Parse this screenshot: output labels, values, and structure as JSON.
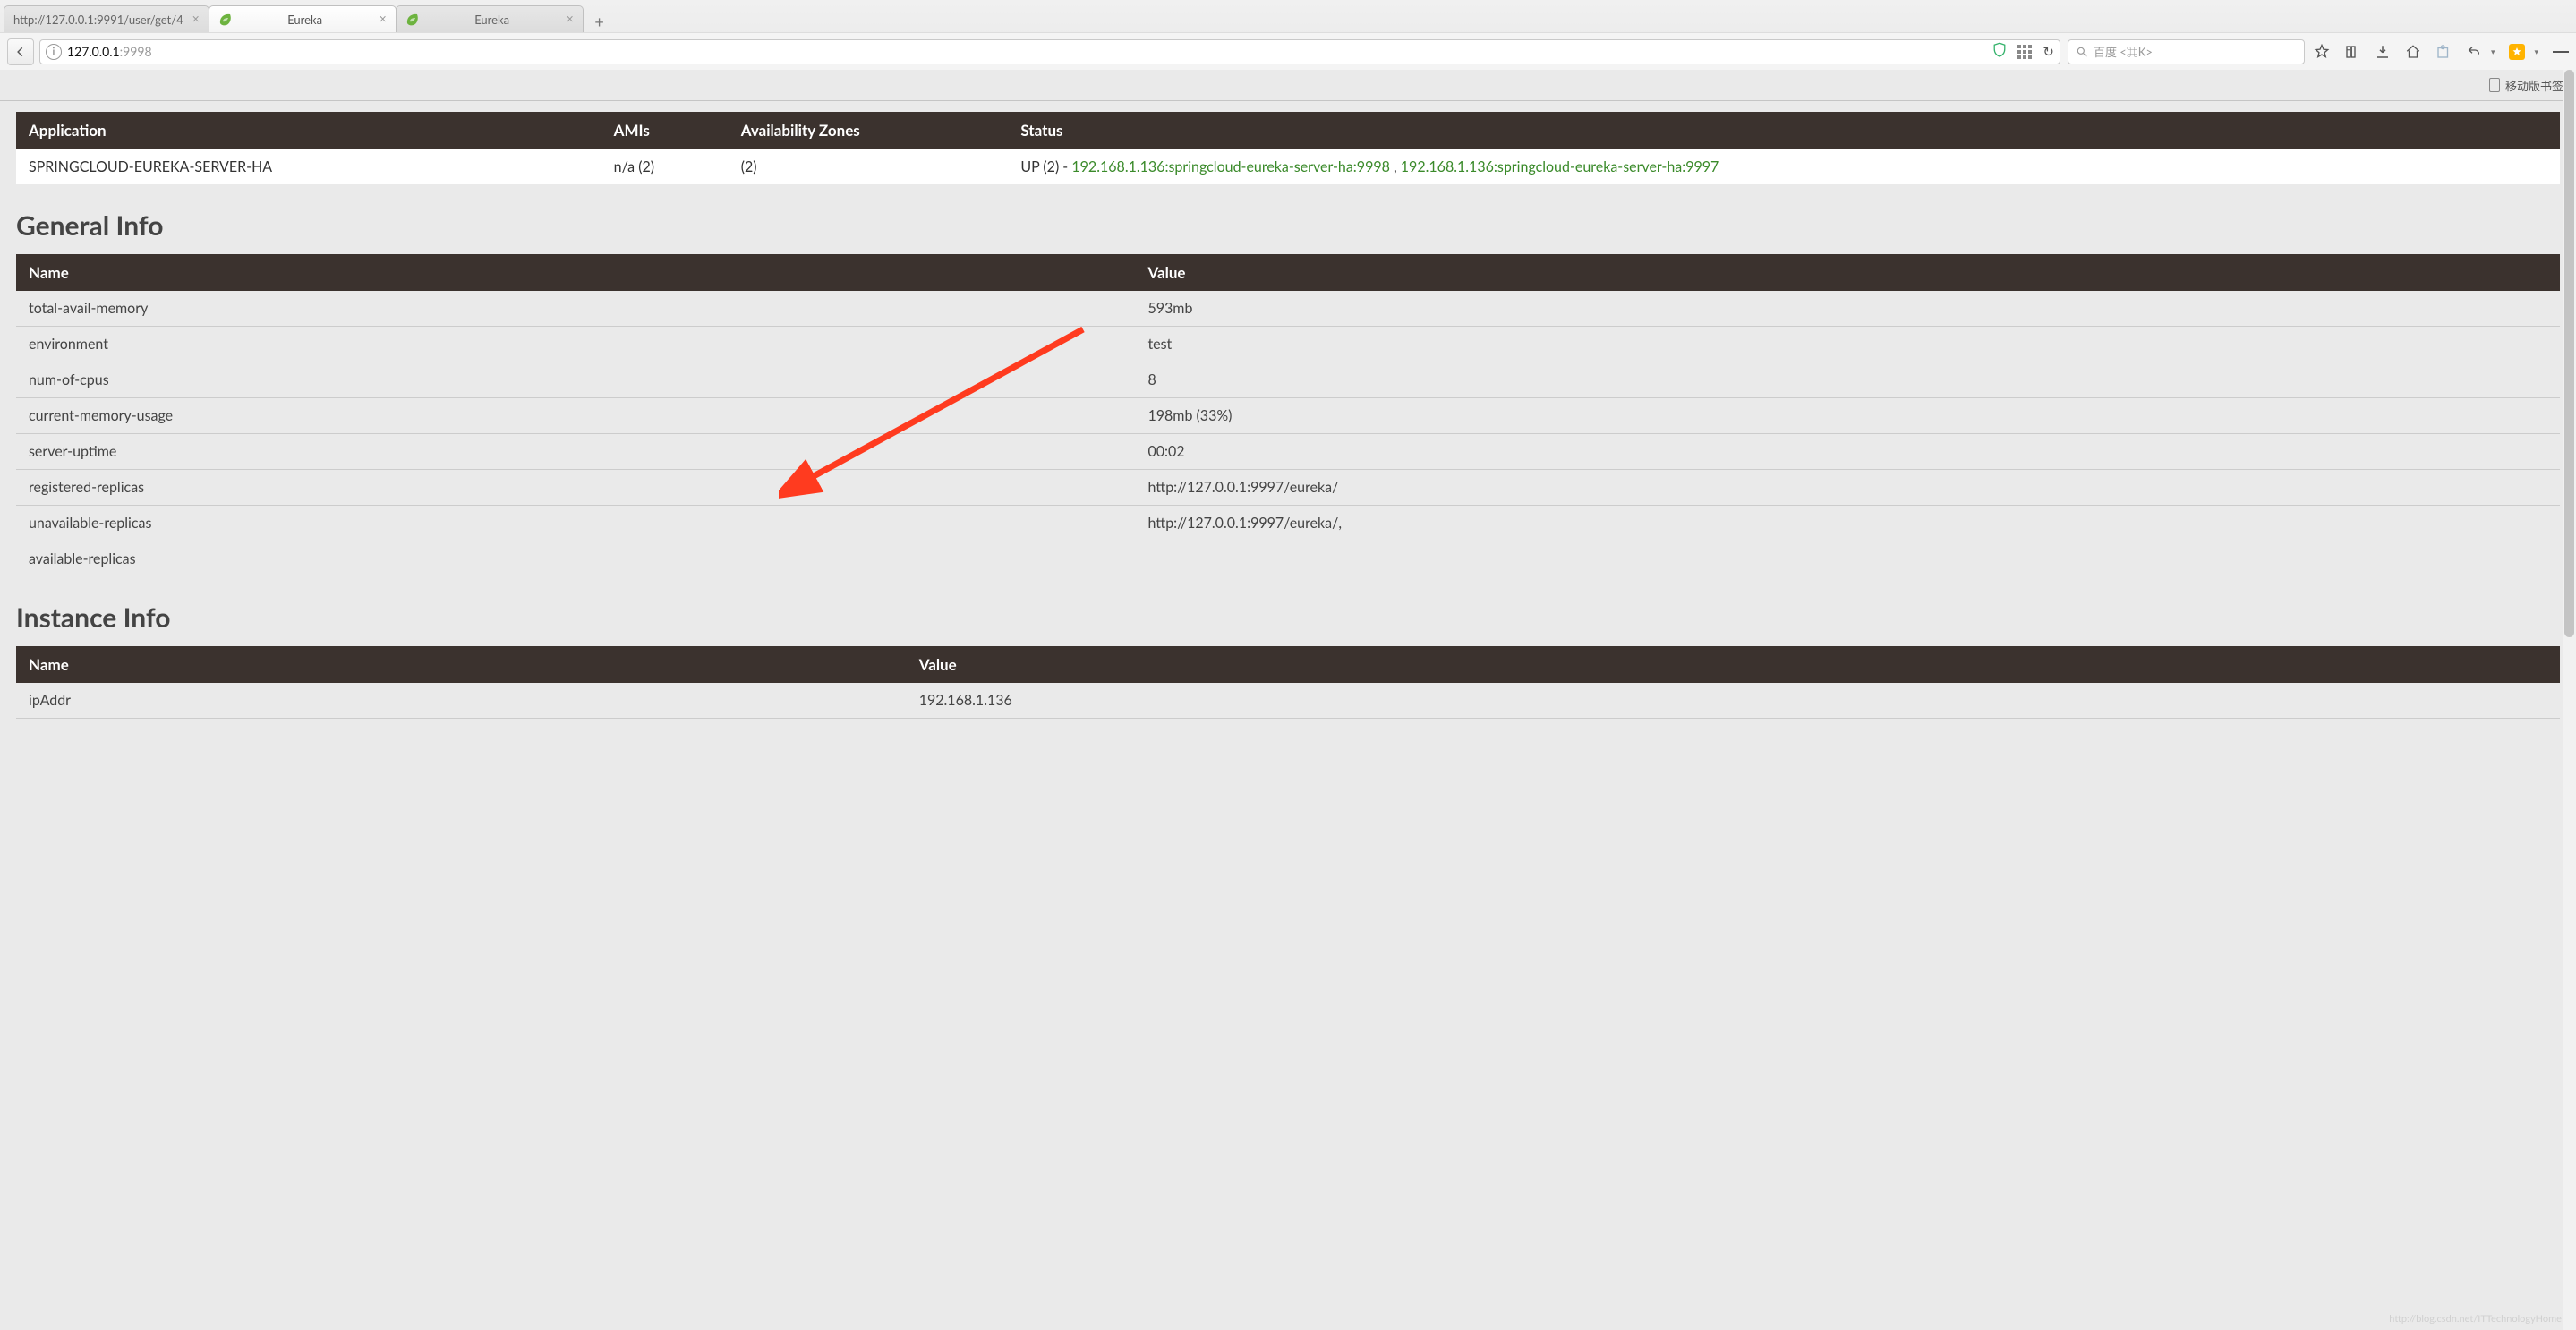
{
  "chrome": {
    "tabs": [
      {
        "title": "http://127.0.0.1:9991/user/get/4",
        "favicon": "none",
        "active": false
      },
      {
        "title": "Eureka",
        "favicon": "spring",
        "active": true
      },
      {
        "title": "Eureka",
        "favicon": "spring",
        "active": false
      }
    ],
    "url_host": "127.0.0.1",
    "url_port": ":9998",
    "search_placeholder": "百度 <⌘K>",
    "bookmark_label": "移动版书签"
  },
  "apps_table": {
    "headers": [
      "Application",
      "AMIs",
      "Availability Zones",
      "Status"
    ],
    "row": {
      "application": "SPRINGCLOUD-EUREKA-SERVER-HA",
      "amis": "n/a (2)",
      "zones": "(2)",
      "status_prefix": "UP (2) - ",
      "status_links": [
        "192.168.1.136:springcloud-eureka-server-ha:9998",
        "192.168.1.136:springcloud-eureka-server-ha:9997"
      ],
      "status_sep": " , "
    }
  },
  "general_info": {
    "title": "General Info",
    "headers": [
      "Name",
      "Value"
    ],
    "rows": [
      {
        "name": "total-avail-memory",
        "value": "593mb"
      },
      {
        "name": "environment",
        "value": "test"
      },
      {
        "name": "num-of-cpus",
        "value": "8"
      },
      {
        "name": "current-memory-usage",
        "value": "198mb (33%)"
      },
      {
        "name": "server-uptime",
        "value": "00:02"
      },
      {
        "name": "registered-replicas",
        "value": "http://127.0.0.1:9997/eureka/"
      },
      {
        "name": "unavailable-replicas",
        "value": "http://127.0.0.1:9997/eureka/,"
      },
      {
        "name": "available-replicas",
        "value": ""
      }
    ]
  },
  "instance_info": {
    "title": "Instance Info",
    "headers": [
      "Name",
      "Value"
    ],
    "rows": [
      {
        "name": "ipAddr",
        "value": "192.168.1.136"
      }
    ]
  },
  "watermark": "http://blog.csdn.net/ITTechnologyHome"
}
